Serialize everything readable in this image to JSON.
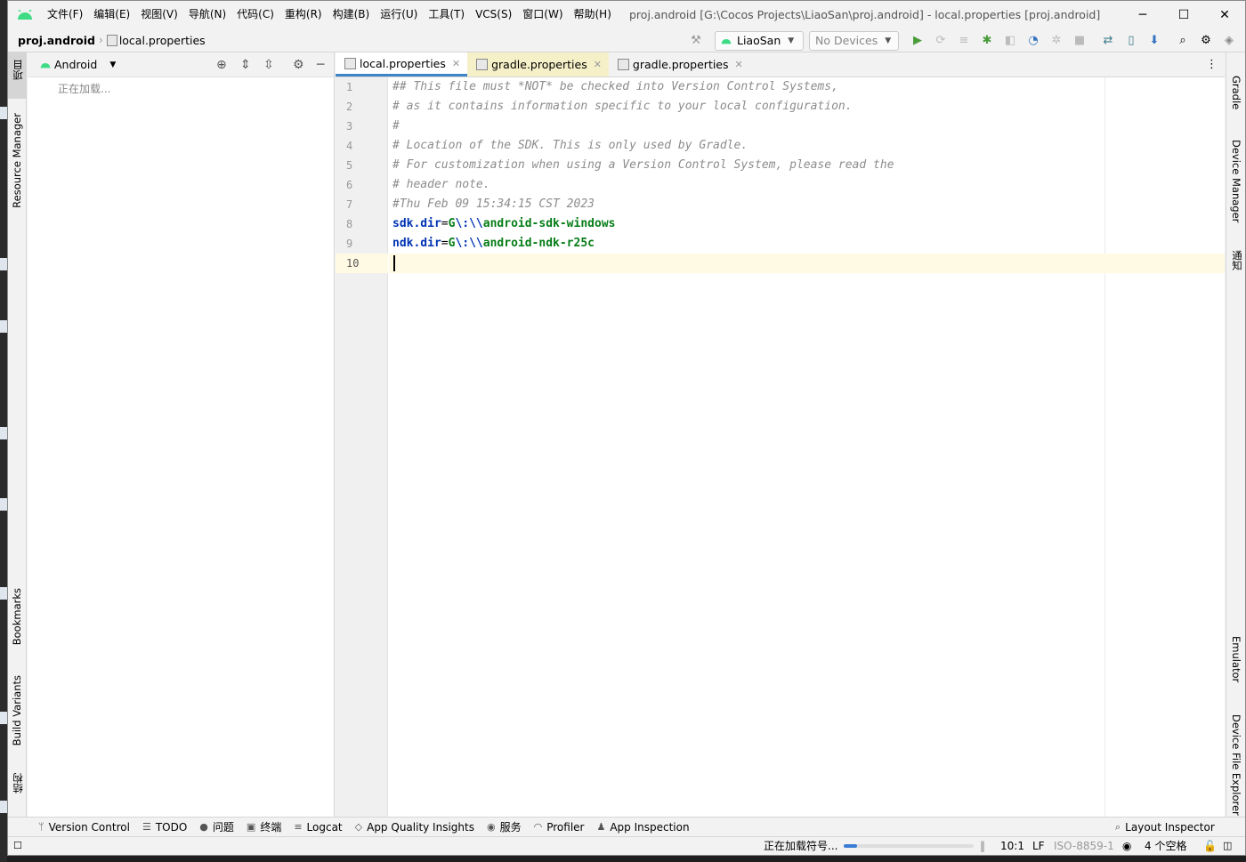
{
  "window": {
    "title": "proj.android [G:\\Cocos Projects\\LiaoSan\\proj.android] - local.properties [proj.android]",
    "menu": [
      "文件(F)",
      "编辑(E)",
      "视图(V)",
      "导航(N)",
      "代码(C)",
      "重构(R)",
      "构建(B)",
      "运行(U)",
      "工具(T)",
      "VCS(S)",
      "窗口(W)",
      "帮助(H)"
    ],
    "controls": {
      "minimize": "─",
      "maximize": "☐",
      "close": "✕"
    }
  },
  "breadcrumb": {
    "project": "proj.android",
    "file": "local.properties"
  },
  "toolbar": {
    "run_config": "LiaoSan",
    "device": "No Devices"
  },
  "left_strip": {
    "project": "项目",
    "resource_manager": "Resource Manager",
    "bookmarks": "Bookmarks",
    "build_variants": "Build Variants",
    "structure": "结构"
  },
  "right_strip": {
    "gradle": "Gradle",
    "device_manager": "Device Manager",
    "notifications": "通知",
    "emulator": "Emulator",
    "device_file_explorer": "Device File Explorer"
  },
  "project_panel": {
    "view": "Android",
    "loading": "正在加载..."
  },
  "tabs": [
    {
      "label": "local.properties"
    },
    {
      "label": "gradle.properties"
    },
    {
      "label": "gradle.properties"
    }
  ],
  "editor": {
    "line_numbers": [
      "1",
      "2",
      "3",
      "4",
      "5",
      "6",
      "7",
      "8",
      "9",
      "10"
    ],
    "comments": [
      "## This file must *NOT* be checked into Version Control Systems,",
      "# as it contains information specific to your local configuration.",
      "#",
      "# Location of the SDK. This is only used by Gradle.",
      "# For customization when using a Version Control System, please read the",
      "# header note.",
      "#Thu Feb 09 15:34:15 CST 2023"
    ],
    "props": [
      {
        "key": "sdk.dir",
        "eq": "=",
        "v1": "G",
        "esc1": "\\:",
        "esc2": "\\\\",
        "v2": "android-sdk-windows"
      },
      {
        "key": "ndk.dir",
        "eq": "=",
        "v1": "G",
        "esc1": "\\:",
        "esc2": "\\\\",
        "v2": "android-ndk-r25c"
      }
    ]
  },
  "bottom_tools": [
    "Version Control",
    "TODO",
    "问题",
    "终端",
    "Logcat",
    "App Quality Insights",
    "服务",
    "Profiler",
    "App Inspection"
  ],
  "layout_inspector": "Layout Inspector",
  "status": {
    "task": "正在加载符号...",
    "progress": 0.1,
    "position": "10:1",
    "line_sep": "LF",
    "encoding": "ISO-8859-1",
    "indent": "4 个空格"
  }
}
